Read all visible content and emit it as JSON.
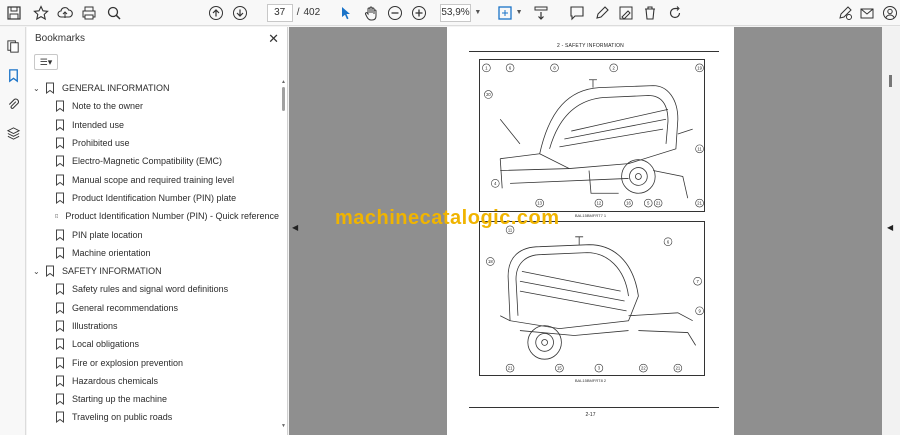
{
  "toolbar": {
    "page_current": "37",
    "page_separator": "/",
    "page_total": "402",
    "zoom": "53,9%"
  },
  "panel": {
    "title": "Bookmarks",
    "close": "✕",
    "options": "☰▾"
  },
  "bookmarks": [
    {
      "label": "GENERAL INFORMATION",
      "level": "top"
    },
    {
      "label": "Note to the owner",
      "level": "sub"
    },
    {
      "label": "Intended use",
      "level": "sub"
    },
    {
      "label": "Prohibited use",
      "level": "sub"
    },
    {
      "label": "Electro-Magnetic Compatibility (EMC)",
      "level": "sub"
    },
    {
      "label": "Manual scope and required training level",
      "level": "sub"
    },
    {
      "label": "Product Identification Number (PIN) plate",
      "level": "sub"
    },
    {
      "label": "Product Identification Number (PIN) - Quick reference",
      "level": "sub"
    },
    {
      "label": "PIN plate location",
      "level": "sub"
    },
    {
      "label": "Machine orientation",
      "level": "sub"
    },
    {
      "label": "SAFETY INFORMATION",
      "level": "top"
    },
    {
      "label": "Safety rules and signal word definitions",
      "level": "sub"
    },
    {
      "label": "General recommendations",
      "level": "sub"
    },
    {
      "label": "Illustrations",
      "level": "sub"
    },
    {
      "label": "Local obligations",
      "level": "sub"
    },
    {
      "label": "Fire or explosion prevention",
      "level": "sub"
    },
    {
      "label": "Hazardous chemicals",
      "level": "sub"
    },
    {
      "label": "Starting up the machine",
      "level": "sub"
    },
    {
      "label": "Traveling on public roads",
      "level": "sub"
    }
  ],
  "document": {
    "header": "2 - SAFETY INFORMATION",
    "fig1_caption": "BAL15BMFRT7   1",
    "fig2_caption": "BAL15BMFRT8   2",
    "footer": "2-17",
    "watermark": "machinecatalogic.com",
    "fig1_callouts": [
      "1",
      "6",
      "8",
      "2",
      "19",
      "20",
      "11",
      "4",
      "21",
      "13",
      "12",
      "16",
      "5",
      "21"
    ],
    "fig2_callouts": [
      "11",
      "18",
      "6",
      "7",
      "9",
      "21",
      "15",
      "3",
      "22",
      "21"
    ]
  },
  "colors": {
    "watermark": "#f0b400",
    "viewer_bg": "#8f8f8f",
    "accent_blue": "#1a73c8"
  }
}
